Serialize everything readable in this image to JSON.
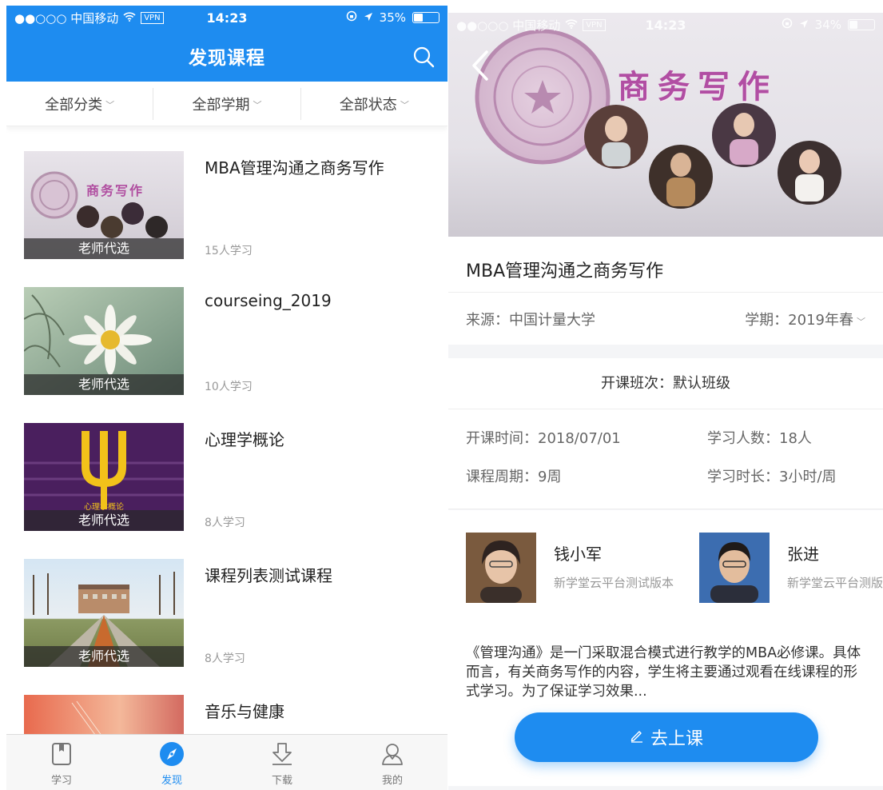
{
  "left": {
    "status": {
      "carrier": "●●○○○ 中国移动",
      "vpn": "VPN",
      "time": "14:23",
      "battery": "35%",
      "battery_level": 0.35
    },
    "nav": {
      "title": "发现课程",
      "search_icon": "search-icon"
    },
    "filters": [
      "全部分类",
      "全部学期",
      "全部状态"
    ],
    "courses": [
      {
        "title": "MBA管理沟通之商务写作",
        "count": "15人学习",
        "tag": "老师代选",
        "thumb_text": "商务写作"
      },
      {
        "title": "courseing_2019",
        "count": "10人学习",
        "tag": "老师代选"
      },
      {
        "title": "心理学概论",
        "count": "8人学习",
        "tag": "老师代选",
        "thumb_text": "心理学概论"
      },
      {
        "title": "课程列表测试课程",
        "count": "8人学习",
        "tag": "老师代选"
      },
      {
        "title": "音乐与健康",
        "count": "",
        "tag": ""
      }
    ],
    "tabs": [
      {
        "label": "学习",
        "icon": "book-icon"
      },
      {
        "label": "发现",
        "icon": "compass-icon",
        "active": true
      },
      {
        "label": "下载",
        "icon": "download-icon"
      },
      {
        "label": "我的",
        "icon": "user-icon"
      }
    ]
  },
  "right": {
    "status": {
      "carrier": "●●○○○ 中国移动",
      "vpn": "VPN",
      "time": "14:23",
      "battery": "34%",
      "battery_level": 0.34
    },
    "banner_text": "商务写作",
    "title": "MBA管理沟通之商务写作",
    "source": "来源：中国计量大学",
    "term": "学期：2019年春",
    "class_line": "开课班次：默认班级",
    "stats": {
      "start": "开课时间：2018/07/01",
      "learners": "学习人数：18人",
      "period": "课程周期：9周",
      "hours": "学习时长：3小时/周"
    },
    "teachers": [
      {
        "name": "钱小军",
        "org": "新学堂云平台测试版本"
      },
      {
        "name": "张进",
        "org": "新学堂云平台测版本"
      }
    ],
    "description": "《管理沟通》是一门采取混合模式进行教学的MBA必修课。具体而言，有关商务写作的内容，学生将主要通过观看在线课程的形式学习。为了保证学习效果...",
    "button": "去上课",
    "colors": {
      "accent": "#1e8cf0",
      "tag_bg": "#282828"
    }
  }
}
